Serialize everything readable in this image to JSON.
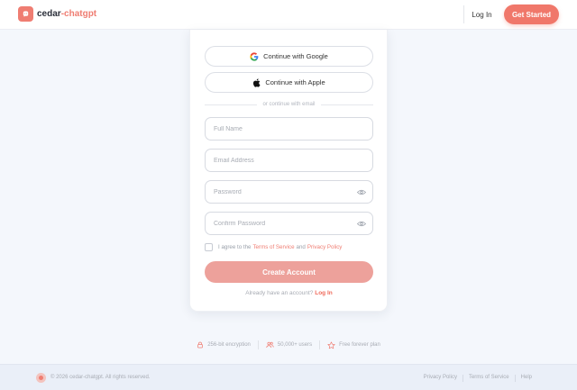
{
  "header": {
    "brand_main": "cedar",
    "brand_accent": "-chatgpt",
    "login_label": "Log In",
    "get_started_label": "Get Started"
  },
  "auth": {
    "google_label": "Continue with Google",
    "apple_label": "Continue with Apple",
    "divider_text": "or continue with email",
    "fields": {
      "full_name_placeholder": "Full Name",
      "email_placeholder": "Email Address",
      "password_placeholder": "Password",
      "confirm_password_placeholder": "Confirm Password"
    },
    "agree_prefix": "I agree to the",
    "terms_label": "Terms of Service",
    "agree_and": "and",
    "privacy_label": "Privacy Policy",
    "create_label": "Create Account",
    "have_account_text": "Already have an account?",
    "login_link": "Log In"
  },
  "badges": [
    {
      "icon": "lock-icon",
      "label": "256-bit encryption"
    },
    {
      "icon": "users-icon",
      "label": "50,000+ users"
    },
    {
      "icon": "star-icon",
      "label": "Free forever plan"
    }
  ],
  "footer": {
    "copyright": "© 2026 cedar-chatgpt. All rights reserved.",
    "links": [
      "Privacy Policy",
      "Terms of Service",
      "Help"
    ]
  },
  "colors": {
    "accent": "#ef7d72",
    "create_button": "#eda19b",
    "background": "#f4f7fc"
  }
}
